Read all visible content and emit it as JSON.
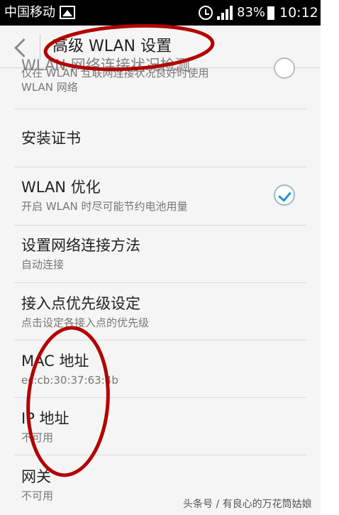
{
  "status_bar": {
    "carrier": "中国移动",
    "battery": "83%",
    "time": "10:12"
  },
  "app_bar": {
    "title": "高级 WLAN 设置"
  },
  "items": [
    {
      "title": "WLAN 网络连接状况检测",
      "subtitle_line1": "仅在 WLAN 互联网连接状况良好时使用",
      "subtitle_line2": "WLAN 网络",
      "checkbox": false
    },
    {
      "title": "安装证书"
    },
    {
      "title": "WLAN 优化",
      "subtitle": "开启 WLAN 时尽可能节约电池用量",
      "checkbox": true
    },
    {
      "title": "设置网络连接方法",
      "subtitle": "自动连接"
    },
    {
      "title": "接入点优先级设定",
      "subtitle": "点击设定各接入点的优先级"
    },
    {
      "title": "MAC 地址",
      "subtitle": "ec:cb:30:37:63:4b"
    },
    {
      "title": "IP 地址",
      "subtitle": "不可用"
    },
    {
      "title": "网关",
      "subtitle": "不可用"
    }
  ],
  "watermark": "头条号 / 有良心的万花筒姑娘",
  "annotation_color": "#b30000"
}
